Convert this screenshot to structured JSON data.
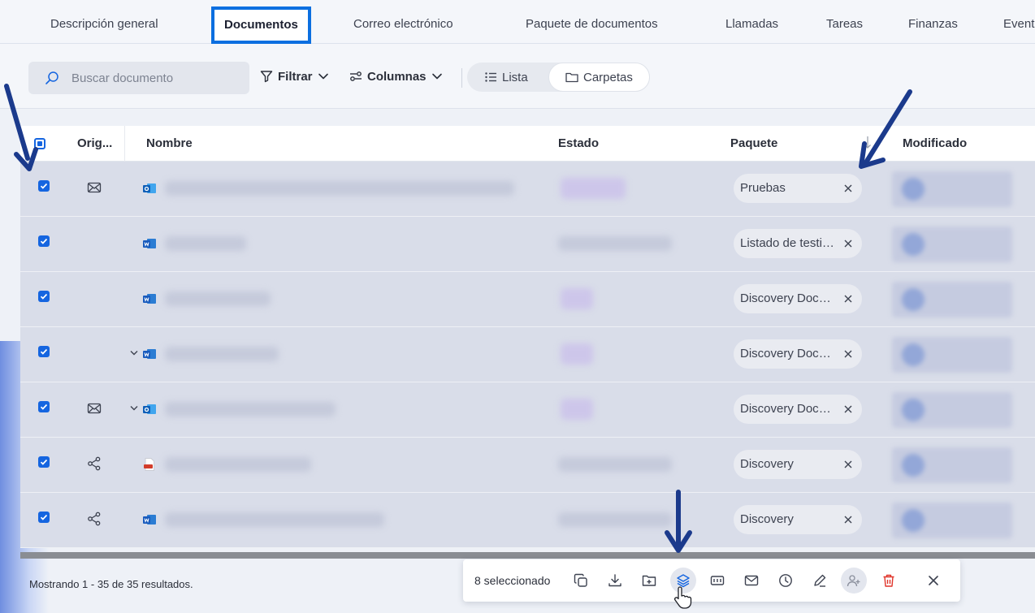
{
  "tabs": [
    {
      "label": "Descripción general"
    },
    {
      "label": "Documentos",
      "active": true
    },
    {
      "label": "Correo electrónico"
    },
    {
      "label": "Paquete de documentos"
    },
    {
      "label": "Llamadas"
    },
    {
      "label": "Tareas"
    },
    {
      "label": "Finanzas"
    },
    {
      "label": "Event"
    }
  ],
  "toolbar": {
    "search_placeholder": "Buscar documento",
    "filter_label": "Filtrar",
    "columns_label": "Columnas",
    "view_list_label": "Lista",
    "view_folders_label": "Carpetas",
    "active_view": "Carpetas"
  },
  "table": {
    "columns": {
      "origin": "Orig...",
      "name": "Nombre",
      "status": "Estado",
      "package": "Paquete",
      "modified": "Modificado"
    },
    "rows": [
      {
        "checked": true,
        "origin_icon": "mail-icon",
        "file_icon": "outlook-icon",
        "expandable": false,
        "package": "Pruebas"
      },
      {
        "checked": true,
        "origin_icon": "",
        "file_icon": "word-icon",
        "expandable": false,
        "package": "Listado de testigos"
      },
      {
        "checked": true,
        "origin_icon": "",
        "file_icon": "word-icon",
        "expandable": false,
        "package": "Discovery Documents"
      },
      {
        "checked": true,
        "origin_icon": "",
        "file_icon": "word-icon",
        "expandable": true,
        "package": "Discovery Documents"
      },
      {
        "checked": true,
        "origin_icon": "mail-icon",
        "file_icon": "outlook-icon",
        "expandable": true,
        "package": "Discovery Documents"
      },
      {
        "checked": true,
        "origin_icon": "share-icon",
        "file_icon": "pdf-icon",
        "expandable": false,
        "package": "Discovery"
      },
      {
        "checked": true,
        "origin_icon": "share-icon",
        "file_icon": "word-icon",
        "expandable": false,
        "package": "Discovery"
      }
    ]
  },
  "footer": {
    "results_text": "Mostrando 1 - 35 de 35 resultados."
  },
  "selection_bar": {
    "count_label": "8 seleccionado",
    "actions": [
      "copy-icon",
      "download-icon",
      "add-to-folder-icon",
      "layers-icon",
      "id-card-icon",
      "mail-icon",
      "clock-icon",
      "edit-icon",
      "add-user-icon",
      "trash-icon",
      "close-icon"
    ]
  },
  "colors": {
    "accent": "#0b6fe0",
    "checkbox": "#1565e0",
    "danger": "#e0342a",
    "annotation_arrow": "#1b3a8c"
  }
}
